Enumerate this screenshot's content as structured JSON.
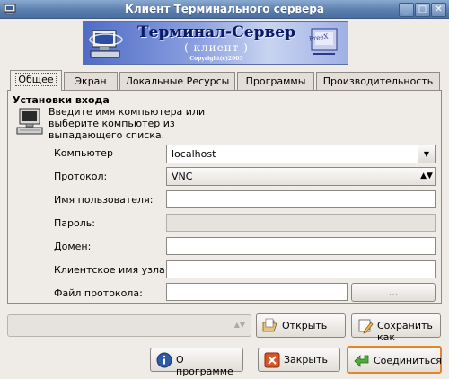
{
  "window": {
    "title": "Клиент Терминального сервера",
    "minimize_glyph": "_",
    "maximize_glyph": "□",
    "close_glyph": "✕"
  },
  "banner": {
    "title": "Терминал-Сервер",
    "subtitle": "( клиент )",
    "copyright": "Copyright(c)2003",
    "logo_text": "FreeX"
  },
  "tabs": [
    {
      "label": "Общее",
      "active": true
    },
    {
      "label": "Экран",
      "active": false
    },
    {
      "label": "Локальные Ресурсы",
      "active": false
    },
    {
      "label": "Программы",
      "active": false
    },
    {
      "label": "Производительность",
      "active": false
    }
  ],
  "login": {
    "section_title": "Установки входа",
    "description": "Введите имя компьютера или выберите компьютер из выпадающего списка.",
    "computer": {
      "label": "Компьютер",
      "value": "localhost"
    },
    "protocol": {
      "label": "Протокол:",
      "value": "VNC"
    },
    "username": {
      "label": "Имя пользователя:",
      "value": ""
    },
    "password": {
      "label": "Пароль:",
      "value": ""
    },
    "domain": {
      "label": "Домен:",
      "value": ""
    },
    "client_hostname": {
      "label": "Клиентское имя узла::",
      "value": ""
    },
    "protocol_file": {
      "label": "Файл протокола:",
      "value": "",
      "browse_label": "..."
    }
  },
  "profile": {
    "selected": "",
    "open_label": "Открыть",
    "save_as_label": "Сохранить как"
  },
  "buttons": {
    "about_label": "О программе",
    "close_label": "Закрыть",
    "connect_label": "Соединиться"
  },
  "colors": {
    "titlebar": "#5b7fae",
    "connect_border": "#e0852c"
  }
}
